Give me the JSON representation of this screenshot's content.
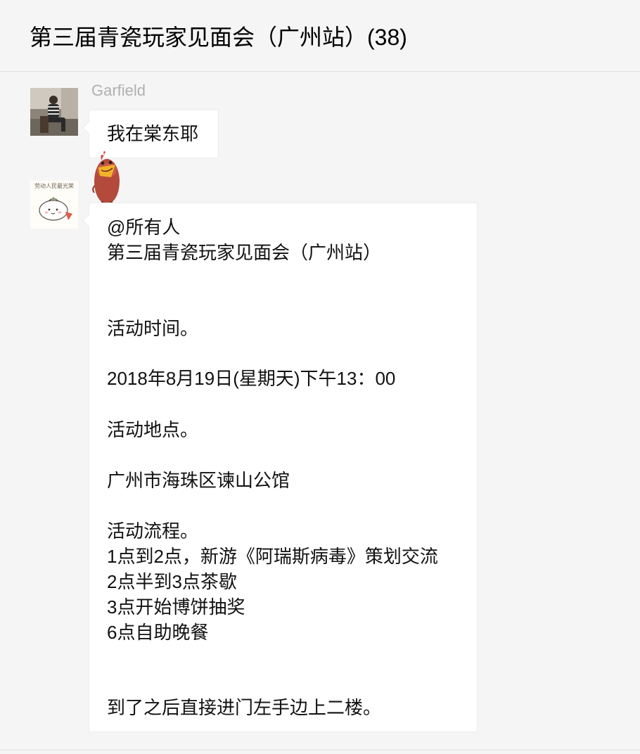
{
  "header": {
    "title": "第三届青瓷玩家见面会（广州站）(38)"
  },
  "messages": [
    {
      "sender": "Garfield",
      "avatar_icon": "man-photo-avatar",
      "text": "我在棠东耶"
    },
    {
      "sender": "",
      "avatar_icon": "cartoon-bun-avatar",
      "avatar_caption": "劳动人民最光荣",
      "sticker_icon": "red-chicken-sticker",
      "lines": [
        "@所有人",
        "第三届青瓷玩家见面会（广州站）",
        "",
        "",
        "活动时间。",
        "",
        "2018年8月19日(星期天)下午13：00",
        "",
        "活动地点。",
        "",
        "广州市海珠区谏山公馆",
        "",
        "活动流程。",
        "1点到2点，新游《阿瑞斯病毒》策划交流",
        "2点半到3点茶歇",
        "3点开始博饼抽奖",
        "6点自助晚餐",
        "",
        "",
        "到了之后直接进门左手边上二楼。"
      ]
    }
  ],
  "colors": {
    "background": "#f5f5f5",
    "bubble": "#ffffff",
    "sender_name": "#b0b0b0",
    "divider": "#e2e2e2",
    "sticker_body": "#b34a3c"
  }
}
